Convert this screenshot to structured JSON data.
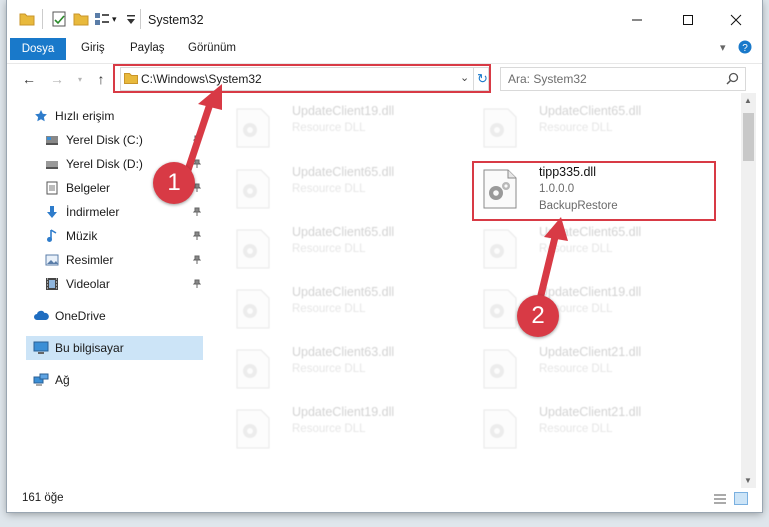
{
  "window": {
    "title": "System32"
  },
  "ribbon": {
    "tabs": [
      "Dosya",
      "Giriş",
      "Paylaş",
      "Görünüm"
    ]
  },
  "address": {
    "path": "C:\\Windows\\System32"
  },
  "search": {
    "placeholder": "Ara: System32"
  },
  "sidebar": {
    "items": [
      {
        "label": "Hızlı erişim",
        "icon": "star-icon"
      },
      {
        "label": "Yerel Disk (C:)",
        "icon": "drive-icon",
        "pinned": true
      },
      {
        "label": "Yerel Disk (D:)",
        "icon": "drive-icon",
        "pinned": true
      },
      {
        "label": "Belgeler",
        "icon": "documents-icon",
        "pinned": true
      },
      {
        "label": "İndirmeler",
        "icon": "download-icon",
        "pinned": true
      },
      {
        "label": "Müzik",
        "icon": "music-icon",
        "pinned": true
      },
      {
        "label": "Resimler",
        "icon": "pictures-icon",
        "pinned": true
      },
      {
        "label": "Videolar",
        "icon": "video-icon",
        "pinned": true
      },
      {
        "label": "OneDrive",
        "icon": "cloud-icon"
      },
      {
        "label": "Bu bilgisayar",
        "icon": "computer-icon",
        "selected": true
      },
      {
        "label": "Ağ",
        "icon": "network-icon"
      }
    ]
  },
  "files": [
    {
      "name": "UpdateClient19.dll",
      "desc": "Resource DLL"
    },
    {
      "name": "UpdateClient65.dll",
      "desc": "Resource DLL"
    },
    {
      "name": "UpdateClient65.dll",
      "desc": "Resource DLL"
    },
    {
      "name": "tipp335.dll",
      "version": "1.0.0.0",
      "desc": "BackupRestore",
      "highlighted": true
    },
    {
      "name": "UpdateClient65.dll",
      "desc": "Resource DLL"
    },
    {
      "name": "UpdateClient65.dll",
      "desc": "Resource DLL"
    },
    {
      "name": "UpdateClient65.dll",
      "desc": "Resource DLL"
    },
    {
      "name": "UpdateClient19.dll",
      "desc": "Resource DLL"
    },
    {
      "name": "UpdateClient63.dll",
      "desc": "Resource DLL"
    },
    {
      "name": "UpdateClient21.dll",
      "desc": "Resource DLL"
    },
    {
      "name": "UpdateClient19.dll",
      "desc": "Resource DLL"
    },
    {
      "name": "UpdateClient21.dll",
      "desc": "Resource DLL"
    }
  ],
  "status": {
    "count": "161 öğe"
  },
  "annotations": {
    "step1": "1",
    "step2": "2"
  },
  "colors": {
    "accent": "#1979ca",
    "highlight": "#d83a45"
  }
}
